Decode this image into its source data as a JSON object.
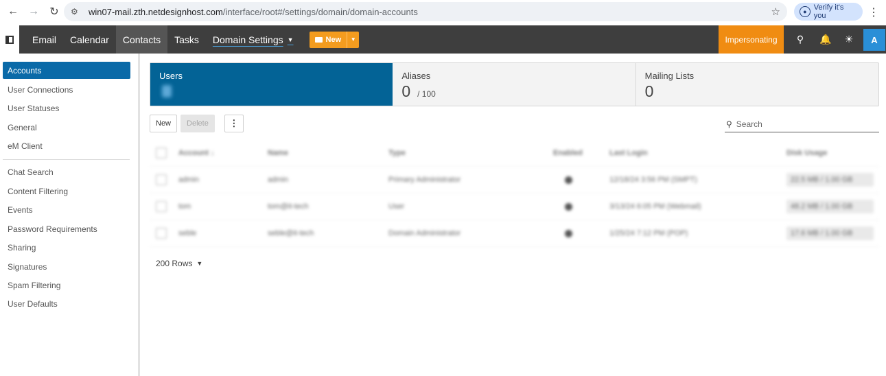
{
  "browser": {
    "url_host": "win07-mail.zth.netdesignhost.com",
    "url_path": "/interface/root#/settings/domain/domain-accounts",
    "verify_label": "Verify it's you"
  },
  "appbar": {
    "nav": [
      {
        "label": "Email"
      },
      {
        "label": "Calendar"
      },
      {
        "label": "Contacts"
      },
      {
        "label": "Tasks"
      },
      {
        "label": "Domain Settings"
      }
    ],
    "new_label": "New",
    "impersonating_label": "Impersonating",
    "avatar_initial": "A"
  },
  "sidebar": {
    "items": [
      {
        "label": "Accounts"
      },
      {
        "label": "User Connections"
      },
      {
        "label": "User Statuses"
      },
      {
        "label": "General"
      },
      {
        "label": "eM Client"
      },
      {
        "label": "Chat Search"
      },
      {
        "label": "Content Filtering"
      },
      {
        "label": "Events"
      },
      {
        "label": "Password Requirements"
      },
      {
        "label": "Sharing"
      },
      {
        "label": "Signatures"
      },
      {
        "label": "Spam Filtering"
      },
      {
        "label": "User Defaults"
      }
    ]
  },
  "cards": [
    {
      "title": "Users",
      "value": ""
    },
    {
      "title": "Aliases",
      "value": "0",
      "sub": "/ 100"
    },
    {
      "title": "Mailing Lists",
      "value": "0"
    }
  ],
  "toolbar": {
    "new_label": "New",
    "delete_label": "Delete",
    "more_label": "⋮"
  },
  "search": {
    "placeholder": "Search"
  },
  "table": {
    "headers": [
      "Account ↓",
      "Name",
      "Type",
      "Enabled",
      "Last Login",
      "Disk Usage"
    ],
    "rows": [
      {
        "account": "admin",
        "name": "admin",
        "type": "Primary Administrator",
        "last_login": "12/18/24 3:56 PM (SMPT)",
        "disk": "22.5 MB / 1.00 GB"
      },
      {
        "account": "tom",
        "name": "tom@it-tech",
        "type": "User",
        "last_login": "3/13/24 6:05 PM (Webmail)",
        "disk": "48.2 MB / 1.00 GB"
      },
      {
        "account": "seble",
        "name": "seble@it-tech",
        "type": "Domain Administrator",
        "last_login": "1/25/24 7:12 PM (POP)",
        "disk": "17.6 MB / 1.00 GB"
      }
    ]
  },
  "pagination": {
    "rows_label": "200 Rows"
  }
}
